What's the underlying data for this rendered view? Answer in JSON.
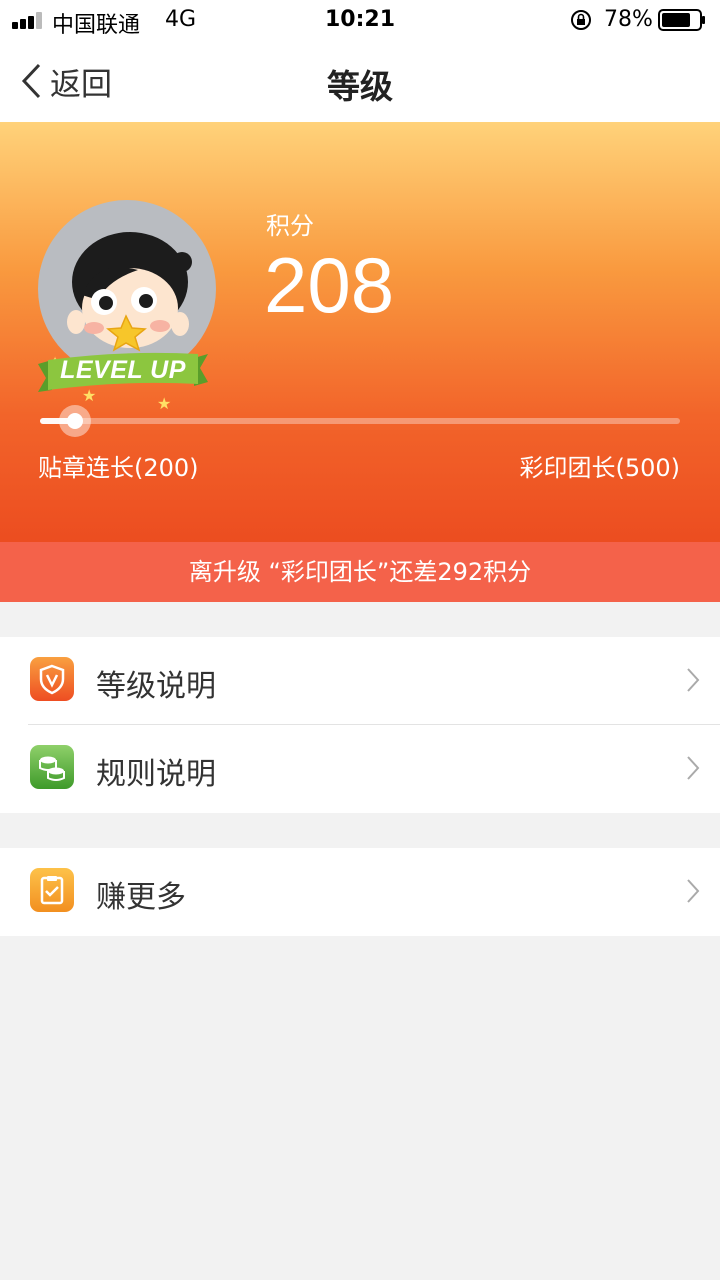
{
  "status_bar": {
    "carrier": "中国联通",
    "network": "4G",
    "time": "10:21",
    "battery": "78%",
    "battery_level": 0.78
  },
  "nav": {
    "back_label": "返回",
    "title": "等级"
  },
  "hero": {
    "points_label": "积分",
    "points_value": "208",
    "badge_text": "LEVEL UP",
    "current_level": "贴章连长(200)",
    "next_level": "彩印团长(500)",
    "progress": 0.027,
    "gap_text": "离升级 “彩印团长”还差292积分"
  },
  "menu": {
    "group1": [
      {
        "label": "等级说明",
        "icon": "shield-v-icon"
      },
      {
        "label": "规则说明",
        "icon": "coins-icon"
      }
    ],
    "group2": [
      {
        "label": "赚更多",
        "icon": "clipboard-check-icon"
      }
    ]
  },
  "colors": {
    "hero_top": "#ffd27a",
    "hero_bottom": "#ec4d20",
    "banner": "#f4624a",
    "shield_icon": "#f0642a",
    "coins_icon": "#5cb03c",
    "clipboard_icon": "#f7a028"
  }
}
